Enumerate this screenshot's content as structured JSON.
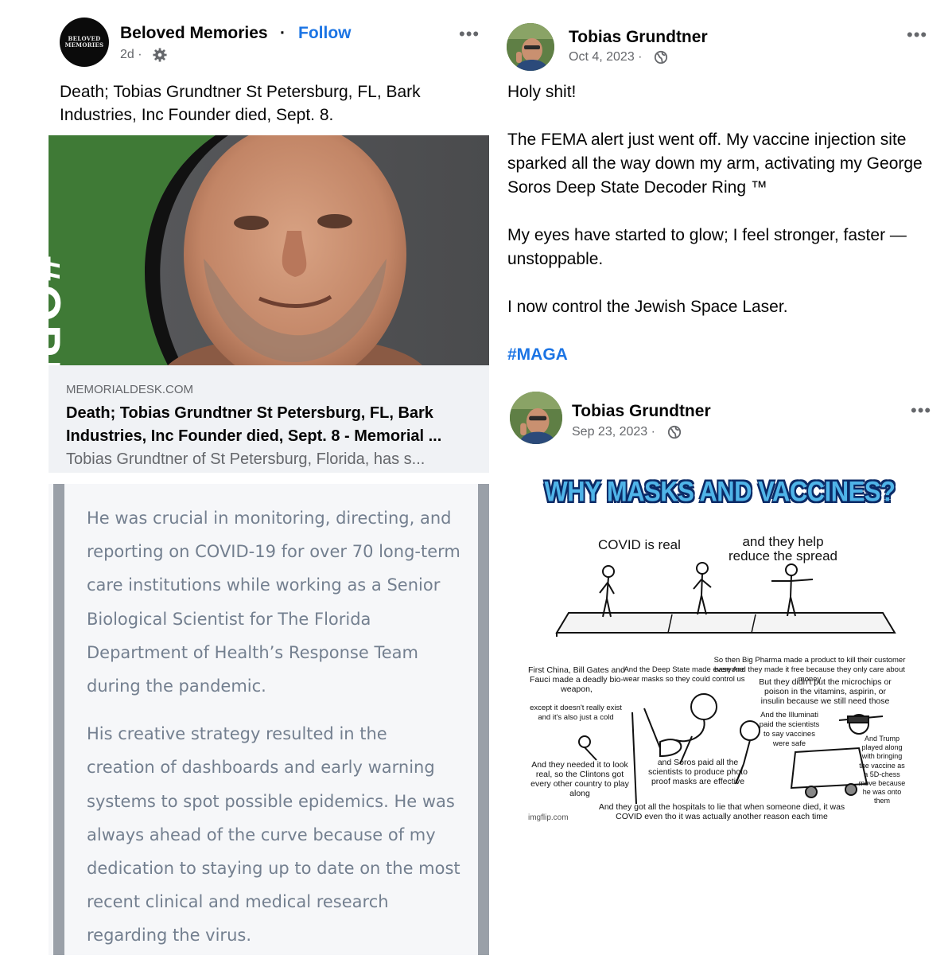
{
  "left_post": {
    "avatar_text": "BELOVED MEMORIES",
    "page_name": "Beloved Memories",
    "separator": "·",
    "follow_label": "Follow",
    "time": "2d ·",
    "more_label": "•••",
    "text": "Death; Tobias Grundtner St Petersburg, FL, Bark Industries, Inc Founder died, Sept. 8.",
    "image_overlay_text": "#OPE",
    "link_card": {
      "domain": "MEMORIALDESK.COM",
      "title_line1": "Death; Tobias Grundtner St Petersburg, FL, Bark",
      "title_line2": "Industries, Inc Founder died, Sept. 8 - Memorial ...",
      "description": "Tobias Grundtner of St Petersburg, Florida, has s..."
    },
    "quote_paragraphs": [
      "He was crucial in monitoring, directing, and reporting on COVID-19 for over 70 long-term care institutions while working as a Senior Biological Scientist for The Florida Department of Health’s Response Team during the pandemic.",
      "His creative strategy resulted in the creation of dashboards and early warning systems to spot possible epidemics. He was always ahead of the curve because of my dedication to staying up to date on the most recent clinical and medical research regarding the virus."
    ]
  },
  "right_post_1": {
    "author": "Tobias Grundtner",
    "time": "Oct 4, 2023 ·",
    "more_label": "•••",
    "p1": "Holy shit!",
    "p2": "The FEMA alert just went off. My vaccine injection site sparked all the way down my arm, activating my George Soros Deep State Decoder Ring ™",
    "p3": "My eyes have started to glow; I feel stronger, faster — unstoppable.",
    "p4": "I now control the Jewish Space Laser.",
    "hashtag": "#MAGA"
  },
  "right_post_2": {
    "author": "Tobias Grundtner",
    "time": "Sep 23, 2023 ·",
    "more_label": "•••",
    "meme": {
      "title": "WHY MASKS AND VACCINES?",
      "caption_left": "COVID is real",
      "caption_right_1": "and they help",
      "caption_right_2": "reduce the spread",
      "t_first_china": "First China, Bill Gates and Fauci made a deadly bio-weapon,",
      "t_except": "except it doesn't really exist and it's also just a cold",
      "t_deep_state": "And the Deep State made everyone wear masks so they could control us",
      "t_big_pharma": "So then Big Pharma made a product to kill their customer base And they made it free because they only care about money",
      "t_microchips": "But they didn't put the microchips or poison in the vitamins, aspirin, or insulin because we still need those",
      "t_illuminati": "And the Illuminati paid the scientists to say vaccines were safe",
      "t_needed": "And they needed it to look real, so the Clintons got every other country to play along",
      "t_soros": "and Soros paid all the scientists to produce photo proof masks are effective",
      "t_trump": "And Trump played along with bringing the vaccine as a 5D-chess move because he was onto them",
      "t_hospitals": "And they got all the hospitals to lie that when someone died, it was COVID even tho it was actually another reason each time",
      "credit": "imgflip.com"
    }
  },
  "colors": {
    "link_blue": "#1b74e4",
    "secondary_text": "#65676b",
    "quote_text": "#737f8f",
    "link_card_bg": "#f0f2f5",
    "meme_title_fill": "#4fb4e8"
  },
  "icons": [
    "gear-icon",
    "globe-icon",
    "more-options-icon"
  ]
}
